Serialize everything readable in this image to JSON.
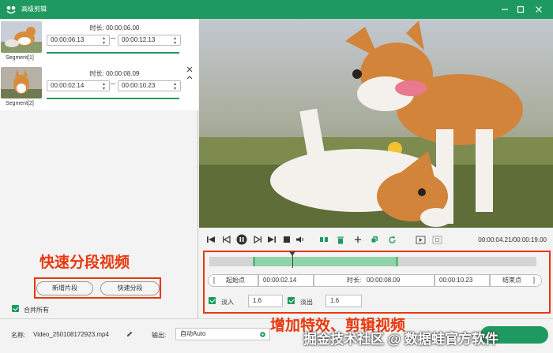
{
  "window": {
    "title": "高级剪辑"
  },
  "segments": [
    {
      "label": "Segment[1]",
      "duration_label": "时长: 00:00:06.00",
      "start": "00:00:06.13",
      "end": "00:00:12.13"
    },
    {
      "label": "Segment[2]",
      "duration_label": "时长: 00:00:08.09",
      "start": "00:00:02.14",
      "end": "00:00:10.23"
    }
  ],
  "annotations": {
    "left": "快速分段视频",
    "right": "增加特效、剪辑视频"
  },
  "buttons": {
    "add_segment": "新增片段",
    "quick_split": "快速分段",
    "start_point": "起始点",
    "end_point": "结束点"
  },
  "merge_all": "合并所有",
  "player": {
    "timecode": "00:00:04.21/00:00:19.00"
  },
  "trim": {
    "start_value": "00:00:02.14",
    "duration_label": "时长:",
    "duration_value": "00:00:08.09",
    "end_value": "00:00:10.23"
  },
  "fade": {
    "fade_in_label": "淡入",
    "fade_in_value": "1.6",
    "fade_out_label": "淡出",
    "fade_out_value": "1.6"
  },
  "bottom": {
    "name_label": "名称:",
    "name_value": "Video_250108172923.mp4",
    "output_label": "输出:",
    "output_value": "自动Auto"
  },
  "watermark": "掘金技术社区 @ 数据蛙官方软件",
  "colors": {
    "brand": "#1e9a60",
    "annotation": "#e8380d"
  }
}
